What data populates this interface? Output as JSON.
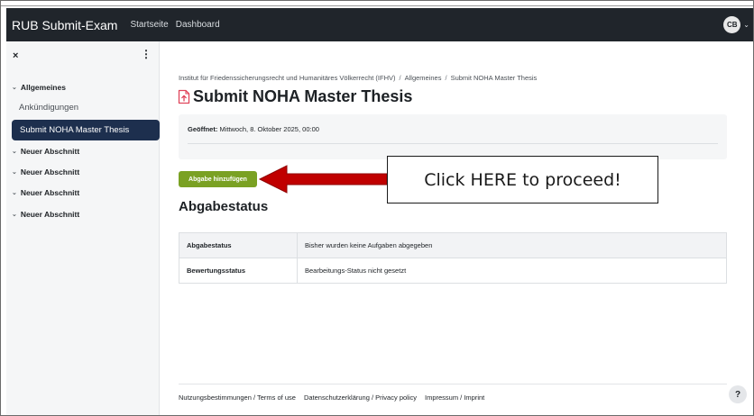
{
  "navbar": {
    "brand": "RUB Submit-Exam",
    "links": [
      "Startseite",
      "Dashboard"
    ],
    "avatar_initials": "CB"
  },
  "sidebar": {
    "close_symbol": "×",
    "menu_symbol": "⋮",
    "sections": [
      {
        "label": "Allgemeines"
      },
      {
        "label": "Neuer Abschnitt"
      },
      {
        "label": "Neuer Abschnitt"
      },
      {
        "label": "Neuer Abschnitt"
      },
      {
        "label": "Neuer Abschnitt"
      }
    ],
    "items": [
      "Ankündigungen",
      "Submit NOHA Master Thesis"
    ],
    "active_item": "Submit NOHA Master Thesis"
  },
  "breadcrumb": [
    "Institut für Friedenssicherungsrecht und Humanitäres Völkerrecht (IFHV)",
    "Allgemeines",
    "Submit NOHA Master Thesis"
  ],
  "breadcrumb_separator": "/",
  "page": {
    "title": "Submit NOHA Master Thesis",
    "opened_label": "Geöffnet:",
    "opened_value": "Mittwoch, 8. Oktober 2025, 00:00",
    "submit_button": "Abgabe hinzufügen",
    "section_title": "Abgabestatus"
  },
  "status_table": {
    "rows": [
      {
        "label": "Abgabestatus",
        "value": "Bisher wurden keine Aufgaben abgegeben"
      },
      {
        "label": "Bewertungsstatus",
        "value": "Bearbeitungs-Status nicht gesetzt"
      }
    ]
  },
  "callout": {
    "text": "Click HERE to proceed!"
  },
  "footer": {
    "links": [
      "Nutzungsbestimmungen / Terms of use",
      "Datenschutzerklärung / Privacy policy",
      "Impressum / Imprint"
    ],
    "help_label": "?"
  },
  "icons": {
    "assignment": "upload-document-icon",
    "arrow": "red-arrow-left-icon"
  },
  "colors": {
    "navbar_bg": "#20252b",
    "active_item_bg": "#1d2f4e",
    "submit_button_bg": "#7aa123",
    "arrow_red": "#c00000",
    "assignment_icon": "#e0455b"
  }
}
